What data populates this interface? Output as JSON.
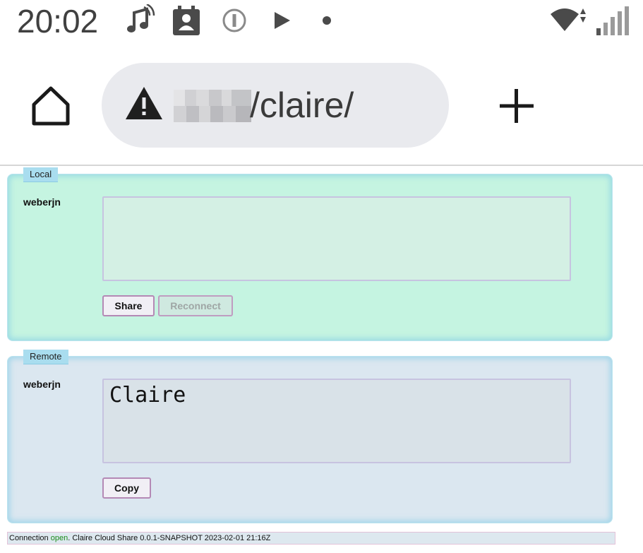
{
  "status_bar": {
    "time": "20:02",
    "icons_left": [
      "music-note-icon",
      "contact-card-icon",
      "info-circle-icon",
      "play-icon",
      "dot-icon"
    ],
    "icons_right": [
      "wifi-icon",
      "cell-signal-icon"
    ]
  },
  "browser": {
    "url_path": "/claire/",
    "warning_icon": "warning-triangle-icon"
  },
  "local": {
    "legend": "Local",
    "user": "weberjn",
    "text_value": "",
    "share_label": "Share",
    "reconnect_label": "Reconnect"
  },
  "remote": {
    "legend": "Remote",
    "user": "weberjn",
    "text_value": "Claire",
    "copy_label": "Copy"
  },
  "footer": {
    "prefix": "Connection ",
    "state": "open",
    "suffix": ". Claire Cloud Share 0.0.1-SNAPSHOT 2023-02-01 21:16Z"
  },
  "colors": {
    "local_bg": "#c5f4e1",
    "remote_bg": "#dbe7f0",
    "open_status": "#1a8a1a"
  }
}
